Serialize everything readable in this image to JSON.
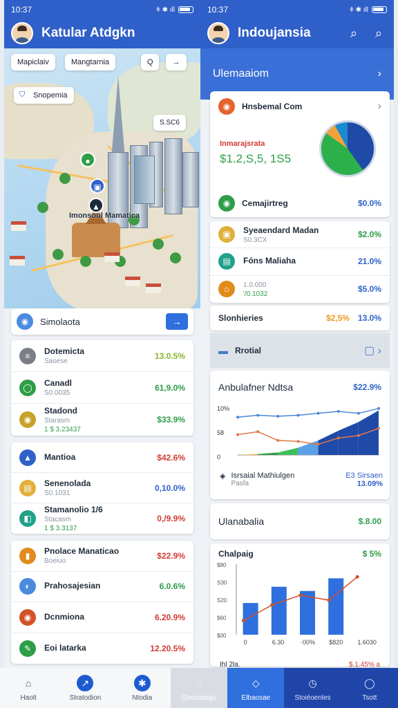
{
  "left": {
    "status": {
      "time": "10:37",
      "signal_text": "ǂ ✱ ıll"
    },
    "title": "Katular Atdgkn",
    "map": {
      "chip_left": "Mapiclaiv",
      "chip_mid": "Mangtarnia",
      "chip_q": "Q",
      "chip_arrow": "→",
      "place_chip": "Snopemia",
      "price_tag": "S.SC6",
      "label": "Imonsoul Mamatica"
    },
    "search": {
      "label": "Simolaota",
      "button": "→"
    },
    "card1": [
      {
        "name": "Dotemicta",
        "sub": "Saoese",
        "value": "13.0.5%",
        "color": "lime",
        "icon": "≡"
      },
      {
        "name": "Canadl",
        "sub": "S0.0035",
        "value": "61,9.0%",
        "color": "green",
        "icon": "◯"
      },
      {
        "name": "Stadond",
        "sub": "Starasm",
        "value": "$33.9%",
        "color": "green",
        "icon": "◉",
        "extra": "1 $ 3.23437"
      }
    ],
    "card2": [
      {
        "name": "Mantioa",
        "sub": "",
        "value": "$42.6%",
        "color": "red",
        "icon": "▲"
      },
      {
        "name": "Senenolada",
        "sub": "S0.1031",
        "value": "0,10.0%",
        "color": "blue",
        "icon": "▤"
      },
      {
        "name": "Stamanolio 1/6",
        "sub": "Stacasm",
        "value": "0,/9.9%",
        "color": "red",
        "icon": "◧",
        "extra": "1 $ 3.3137"
      }
    ],
    "card3": [
      {
        "name": "Pnolace Manaticao",
        "sub": "Boeiuo",
        "value": "$22.9%",
        "color": "red",
        "icon": "▮"
      },
      {
        "name": "Prahosajesian",
        "sub": "",
        "value": "6.0.6%",
        "color": "green",
        "icon": "◐"
      },
      {
        "name": "Dcnmiona",
        "sub": "",
        "value": "6.20.9%",
        "color": "red",
        "icon": "◉"
      },
      {
        "name": "Eoi latarka",
        "sub": "",
        "value": "12.20.5%",
        "color": "red",
        "icon": "✎"
      }
    ]
  },
  "right": {
    "status": {
      "time": "10:37",
      "signal_text": "ǂ ✱ ıll"
    },
    "title": "Indoujansia",
    "banner": {
      "label": "Ulemaaiom",
      "arrow": "›"
    },
    "summary": {
      "title": "Hnsbemal Com",
      "caption": "Inmarajsrata",
      "value": "$1.2,S,5, 1S5",
      "footer_label": "Cemajirtreg",
      "footer_value": "$0.0%",
      "donut_pct": {
        "blue": 40,
        "green": 45,
        "orange": 7,
        "teal": 8
      }
    },
    "list": [
      {
        "name": "Syeaendard Madan",
        "sub": "S0.3CX",
        "value": "$2.0%",
        "color": "green",
        "icon": "▣"
      },
      {
        "name": "Fóns Maliahа",
        "sub": "",
        "value": "21.0%",
        "color": "blue",
        "icon": "▤"
      },
      {
        "name": "",
        "sub": "1.0.000",
        "value": "$5.0%",
        "color": "blue",
        "icon": "⌂",
        "extra": "'/0.1032"
      }
    ],
    "stats": {
      "label": "Slonhieries",
      "v1": "$2,5%",
      "v2": "13.0%"
    },
    "retail": {
      "label": "Rrotial"
    },
    "chart1": {
      "title": "Anbulafner Ndtsa",
      "value": "$22.9%",
      "legend_left": "Isrsaial Mathiulgen",
      "legend_left_sub": "Pasfa",
      "legend_right": "E3 Sirsaen",
      "legend_right_value": "13.09%"
    },
    "mid_row": {
      "label": "Ulanabalia",
      "value": "$.8.00"
    },
    "chart2": {
      "title": "Chalpaig",
      "value": "$ 5%",
      "bottom_left": "Ihl 2la.",
      "bottom_right": "$.1.45% a"
    }
  },
  "nav": [
    {
      "label": "Haolt",
      "icon": "⌂"
    },
    {
      "label": "Stratodion",
      "icon": "↗"
    },
    {
      "label": "Ntodia",
      "icon": "✱"
    },
    {
      "label": "Gecinaoigo",
      "icon": "◌"
    },
    {
      "label": "Elbaosae",
      "icon": "◇"
    },
    {
      "label": "Stoiéoenles",
      "icon": "◷"
    },
    {
      "label": "Tsott",
      "icon": "◯"
    }
  ],
  "chart_data": [
    {
      "type": "area",
      "title": "Anbulafner Ndtsa",
      "y_ticks": [
        "10%",
        "58",
        "0"
      ],
      "ylim": [
        0,
        100
      ],
      "x": [
        0,
        1,
        2,
        3,
        4,
        5,
        6,
        7
      ],
      "series": [
        {
          "values": [
            78,
            82,
            80,
            82,
            86,
            90,
            86,
            96
          ],
          "color": "#4a86d4"
        },
        {
          "values": [
            42,
            48,
            30,
            28,
            22,
            35,
            40,
            55
          ],
          "color": "#e0754a"
        },
        {
          "values": [
            0,
            2,
            5,
            15,
            30,
            50,
            68,
            92
          ],
          "color": "#2f9d48"
        }
      ]
    },
    {
      "type": "bar",
      "title": "Chalpaig",
      "categories": [
        "0",
        "6.30",
        "·00%",
        "$820",
        "1.6030"
      ],
      "y_ticks": [
        "$80",
        "S30",
        "S20",
        "$60",
        "$00"
      ],
      "ylim": [
        0,
        100
      ],
      "values": [
        45,
        68,
        62,
        80,
        0
      ],
      "line": [
        20,
        42,
        56,
        49,
        82
      ]
    }
  ]
}
